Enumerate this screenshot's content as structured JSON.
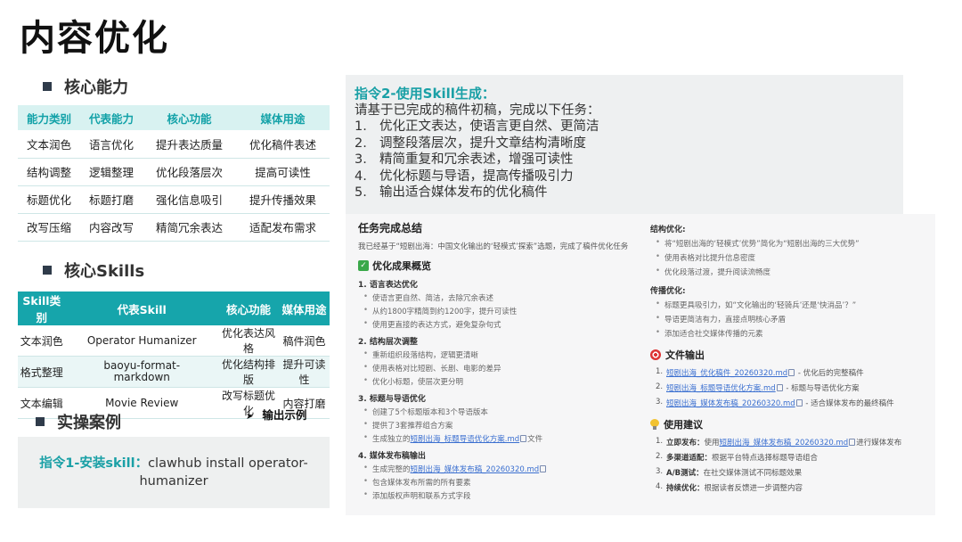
{
  "page_title": "内容优化",
  "sections": {
    "core_ability": "核心能力",
    "core_skills": "核心Skills",
    "practice": "实操案例"
  },
  "ability_table": {
    "headers": [
      "能力类别",
      "代表能力",
      "核心功能",
      "媒体用途"
    ],
    "rows": [
      [
        "文本润色",
        "语言优化",
        "提升表达质量",
        "优化稿件表述"
      ],
      [
        "结构调整",
        "逻辑整理",
        "优化段落层次",
        "提高可读性"
      ],
      [
        "标题优化",
        "标题打磨",
        "强化信息吸引",
        "提升传播效果"
      ],
      [
        "改写压缩",
        "内容改写",
        "精简冗余表达",
        "适配发布需求"
      ]
    ]
  },
  "skills_table": {
    "headers": [
      "Skill类别",
      "代表Skill",
      "核心功能",
      "媒体用途"
    ],
    "rows": [
      [
        "文本润色",
        "Operator Humanizer",
        "优化表达风格",
        "稿件润色"
      ],
      [
        "格式整理",
        "baoyu-format-markdown",
        "优化结构排版",
        "提升可读性"
      ],
      [
        "文本编辑",
        "Movie Review",
        "改写标题优化",
        "内容打磨"
      ]
    ]
  },
  "output_example": "输出示例",
  "command1": {
    "label": "指令1-安装skill：",
    "text": "clawhub install operator-humanizer"
  },
  "command2": {
    "label": "指令2-使用Skill生成：",
    "intro": "请基于已完成的稿件初稿，完成以下任务：",
    "items": [
      {
        "num": "1.",
        "text": "优化正文表达，使语言更自然、更简洁"
      },
      {
        "num": "2.",
        "text": "调整段落层次，提升文章结构清晰度"
      },
      {
        "num": "3.",
        "text": "精简重复和冗余表述，增强可读性"
      },
      {
        "num": "4.",
        "text": "优化标题与导语，提高传播吸引力"
      },
      {
        "num": "5.",
        "text": "输出适合媒体发布的优化稿件"
      }
    ]
  },
  "screenshot": {
    "summary_title": "任务完成总结",
    "summary_intro": "我已经基于“短剧出海：中国文化输出的‘轻模式’探索”选题，完成了稿件优化任务",
    "overview_title": "优化成果概览",
    "left_groups": [
      {
        "title": "1. 语言表达优化",
        "items": [
          "使语言更自然、简洁，去除冗余表述",
          "从约1800字精简到约1200字，提升可读性",
          "使用更直接的表达方式，避免复杂句式"
        ]
      },
      {
        "title": "2. 结构层次调整",
        "items": [
          "重新组织段落结构，逻辑更清晰",
          "使用表格对比短剧、长剧、电影的差异",
          "优化小标题，使层次更分明"
        ]
      },
      {
        "title": "3. 标题与导语优化",
        "items": [
          "创建了5个标题版本和3个导语版本",
          "提供了3套推荐组合方案"
        ]
      }
    ],
    "left_link_item": {
      "pre": "生成独立的",
      "link": "短剧出海_标题导语优化方案.md",
      "post": "文件"
    },
    "group4_title": "4. 媒体发布稿输出",
    "group4_link_item": {
      "pre": "生成完整的",
      "link": "短剧出海_媒体发布稿_20260320.md"
    },
    "group4_items": [
      "包含媒体发布所需的所有要素",
      "添加版权声明和联系方式字段"
    ],
    "right_groups": [
      {
        "title": "结构优化:",
        "items": [
          "将“短剧出海的‘轻模式’优势”简化为“短剧出海的三大优势”",
          "使用表格对比提升信息密度",
          "优化段落过渡，提升阅读流畅度"
        ]
      },
      {
        "title": "传播优化:",
        "items": [
          "标题更具吸引力，如“文化输出的‘轻骑兵’还是‘快消品’？”",
          "导语更简洁有力，直接点明核心矛盾",
          "添加适合社交媒体传播的元素"
        ]
      }
    ],
    "files_title": "文件输出",
    "files": [
      {
        "num": "1.",
        "link": "短剧出海_优化稿件_20260320.md",
        "desc": "- 优化后的完整稿件"
      },
      {
        "num": "2.",
        "link": "短剧出海_标题导语优化方案.md",
        "desc": "- 标题与导语优化方案"
      },
      {
        "num": "3.",
        "link": "短剧出海_媒体发布稿_20260320.md",
        "desc": "- 适合媒体发布的最终稿件"
      }
    ],
    "advice_title": "使用建议",
    "advice": [
      {
        "num": "1.",
        "bold": "立即发布：",
        "pre": "使用",
        "link": "短剧出海_媒体发布稿_20260320.md",
        "post": "进行媒体发布"
      },
      {
        "num": "2.",
        "bold": "多渠道适配：",
        "text": "根据平台特点选择标题导语组合"
      },
      {
        "num": "3.",
        "bold": "A/B测试：",
        "text": "在社交媒体测试不同标题效果"
      },
      {
        "num": "4.",
        "bold": "持续优化：",
        "text": "根据读者反馈进一步调整内容"
      }
    ]
  }
}
